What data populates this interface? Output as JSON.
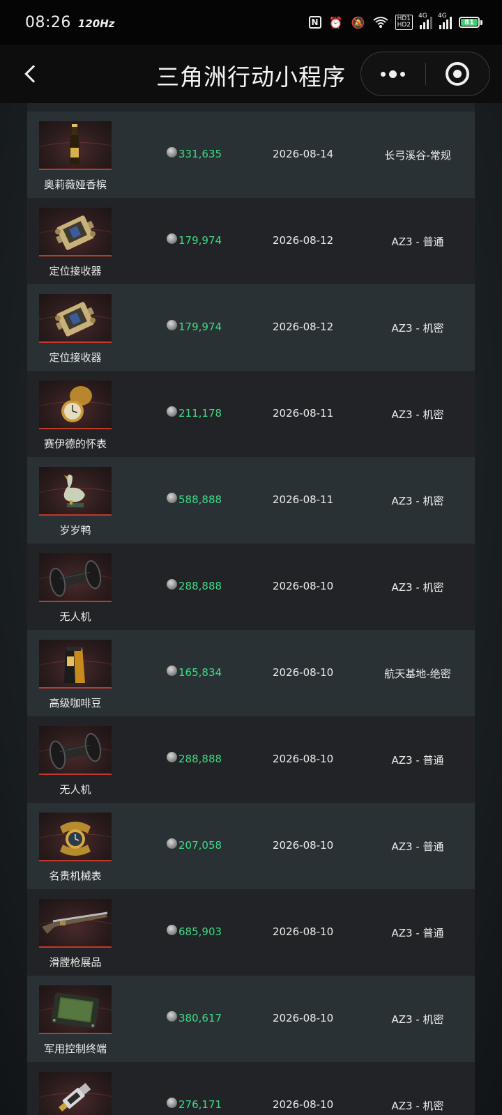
{
  "status_bar": {
    "time": "08:26",
    "refresh_rate": "120Hz",
    "nfc_label": "N",
    "hd_label_1": "HD1",
    "hd_label_2": "HD2",
    "sim1_label": "4G",
    "sim2_label": "4G",
    "battery_level": "81"
  },
  "nav": {
    "title": "三角洲行动小程序"
  },
  "list": {
    "items": [
      {
        "name": "奥莉薇娅香槟",
        "price": "331,635",
        "date": "2026-08-14",
        "map": "长弓溪谷-常规",
        "icon": "champagne-bottle"
      },
      {
        "name": "定位接收器",
        "price": "179,974",
        "date": "2026-08-12",
        "map": "AZ3 - 普通",
        "icon": "positioning-receiver"
      },
      {
        "name": "定位接收器",
        "price": "179,974",
        "date": "2026-08-12",
        "map": "AZ3 - 机密",
        "icon": "positioning-receiver"
      },
      {
        "name": "赛伊德的怀表",
        "price": "211,178",
        "date": "2026-08-11",
        "map": "AZ3 - 机密",
        "icon": "pocket-watch"
      },
      {
        "name": "岁岁鸭",
        "price": "588,888",
        "date": "2026-08-11",
        "map": "AZ3 - 机密",
        "icon": "duck-statue"
      },
      {
        "name": "无人机",
        "price": "288,888",
        "date": "2026-08-10",
        "map": "AZ3 - 机密",
        "icon": "drone"
      },
      {
        "name": "高级咖啡豆",
        "price": "165,834",
        "date": "2026-08-10",
        "map": "航天基地-绝密",
        "icon": "coffee-bag"
      },
      {
        "name": "无人机",
        "price": "288,888",
        "date": "2026-08-10",
        "map": "AZ3 - 普通",
        "icon": "drone"
      },
      {
        "name": "名贵机械表",
        "price": "207,058",
        "date": "2026-08-10",
        "map": "AZ3 - 普通",
        "icon": "luxury-watch"
      },
      {
        "name": "滑膛枪展品",
        "price": "685,903",
        "date": "2026-08-10",
        "map": "AZ3 - 普通",
        "icon": "musket"
      },
      {
        "name": "军用控制终端",
        "price": "380,617",
        "date": "2026-08-10",
        "map": "AZ3 - 机密",
        "icon": "control-terminal"
      },
      {
        "name": "",
        "price": "276,171",
        "date": "2026-08-10",
        "map": "AZ3 - 机密",
        "icon": "usb-key"
      }
    ]
  },
  "colors": {
    "price_green": "#3ddc84",
    "row_light": "#2a3135",
    "row_dark": "#222326",
    "thumb_accent": "#c0392b"
  }
}
